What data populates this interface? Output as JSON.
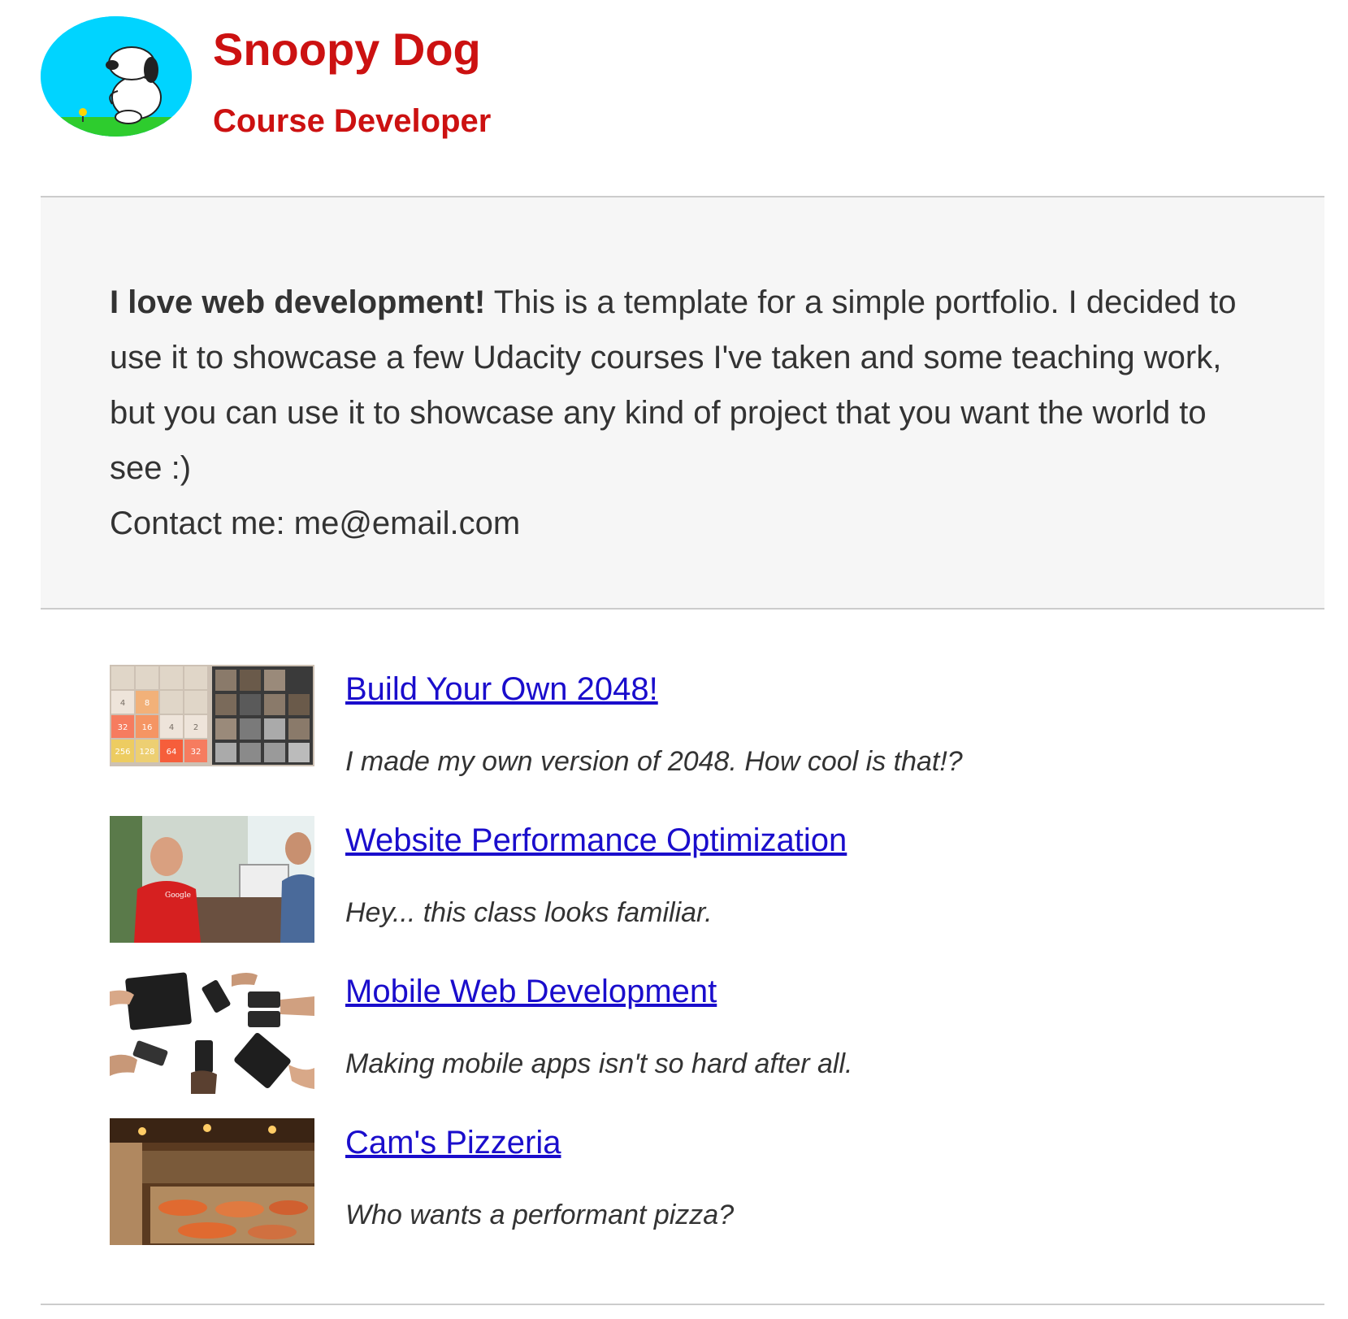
{
  "header": {
    "name": "Snoopy Dog",
    "role": "Course Developer",
    "avatar_icon": "snoopy-avatar"
  },
  "intro": {
    "bold_lead": "I love web development!",
    "body": " This is a template for a simple portfolio. I decided to use it to showcase a few Udacity courses I've taken and some teaching work, but you can use it to showcase any kind of project that you want the world to see :)",
    "contact": "Contact me: me@email.com"
  },
  "projects": [
    {
      "title": "Build Your Own 2048!",
      "description": "I made my own version of 2048. How cool is that!?",
      "thumb_labels": [
        "4",
        "8",
        "32",
        "16",
        "4",
        "2",
        "256",
        "128",
        "64",
        "32"
      ]
    },
    {
      "title": "Website Performance Optimization",
      "description": "Hey... this class looks familiar.",
      "thumb_labels": [
        "Google"
      ]
    },
    {
      "title": "Mobile Web Development",
      "description": "Making mobile apps isn't so hard after all."
    },
    {
      "title": "Cam's Pizzeria",
      "description": "Who wants a performant pizza?"
    }
  ],
  "colors": {
    "accent": "#cc1111",
    "link": "#1a0dcc",
    "panel": "#f6f6f6",
    "rule": "#cccccc"
  }
}
